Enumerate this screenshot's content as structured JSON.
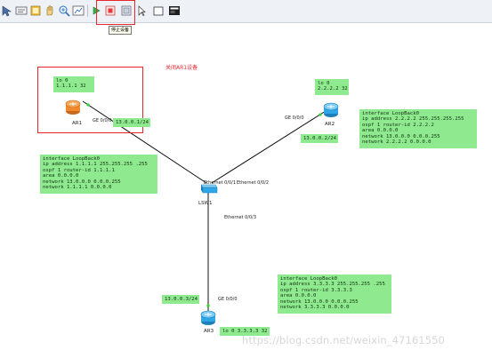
{
  "toolbar": {
    "tooltip": "停止设备"
  },
  "annotation": {
    "text": "关闭AR1设备"
  },
  "devices": {
    "ar1": {
      "name": "AR1",
      "port": "GE 0/0/0",
      "lo": "lo 0\n1.1.1.1 32",
      "ip": "13.0.0.1/24"
    },
    "ar2": {
      "name": "AR2",
      "port": "GE 0/0/0",
      "lo": "lo 0\n2.2.2.2 32",
      "ip": "13.0.0.2/24"
    },
    "ar3": {
      "name": "AR3",
      "port": "GE 0/0/0",
      "lo": "lo 0 3.3.3.3 32",
      "ip": "13.0.0.3/24"
    },
    "lsw1": {
      "name": "LSW1",
      "port1": "Ethernet 0/0/1",
      "port2": "Ethernet 0/0/2",
      "port3": "Ethernet 0/0/3"
    }
  },
  "configs": {
    "ar1": "interface LoopBack0\nip address 1.1.1.1 255.255.255 .255\nospf 1 router-id 1.1.1.1\narea 0.0.0.0\nnetwork 13.0.0.0 0.0.0.255\nnetwork 1.1.1.1 0.0.0.0",
    "ar2": "interface LoopBack0\nip address 2.2.2.2 255.255.255.255\nospf 1 router-id 2.2.2.2\narea 0.0.0.0\nnetwork 13.0.0.0 0.0.0.255\nnetwork 2.2.2.2 0.0.0.0",
    "ar3": "interface LoopBack0\nip address 3.3.3.3 255.255.255 .255\nospf 1 router-id 3.3.3.3\narea 0.0.0.0\nnetwork 13.0.0.0 0.0.0.255\nnetwork 3.3.3.3 0.0.0.0"
  },
  "watermark": "https://blog.csdn.net/weixin_47161550",
  "colors": {
    "label_bg": "#8fea8f",
    "highlight": "#e8262b",
    "router": "#2fa6e8",
    "router_off": "#f08a2c"
  }
}
